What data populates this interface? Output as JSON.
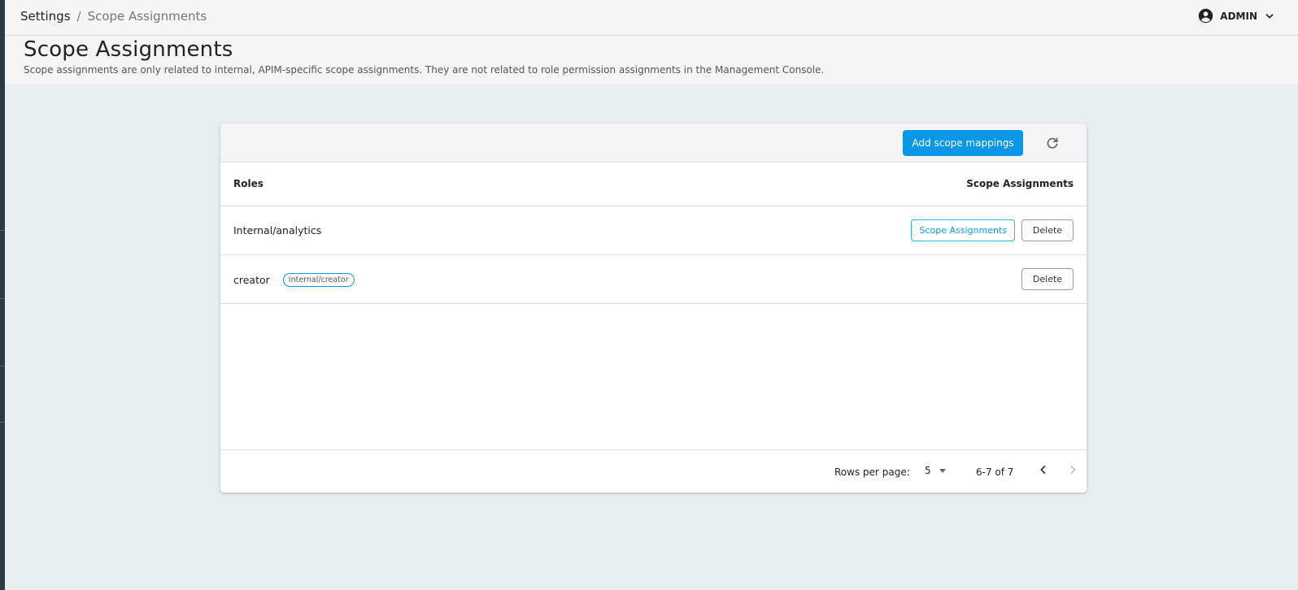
{
  "breadcrumb": {
    "root": "Settings",
    "separator": "/",
    "current": "Scope Assignments"
  },
  "user": {
    "name": "ADMIN",
    "icon": "account-circle-icon"
  },
  "page": {
    "title": "Scope Assignments",
    "description": "Scope assignments are only related to internal, APIM-specific scope assignments. They are not related to role permission assignments in the Management Console."
  },
  "toolbar": {
    "add_label": "Add scope mappings",
    "refresh_icon": "refresh-icon"
  },
  "table": {
    "columns": [
      "Roles",
      "Scope Assignments"
    ],
    "rows": [
      {
        "role": "Internal/analytics",
        "chip": "",
        "scope_button": "Scope Assignments",
        "delete_button": "Delete"
      },
      {
        "role": "creator",
        "chip": "Internal/creator",
        "scope_button": "",
        "delete_button": "Delete"
      }
    ]
  },
  "pagination": {
    "rows_per_page_label": "Rows per page:",
    "rows_per_page_value": "5",
    "range": "6-7 of 7"
  },
  "colors": {
    "primary": "#0a97e8",
    "background": "#e8edef"
  }
}
